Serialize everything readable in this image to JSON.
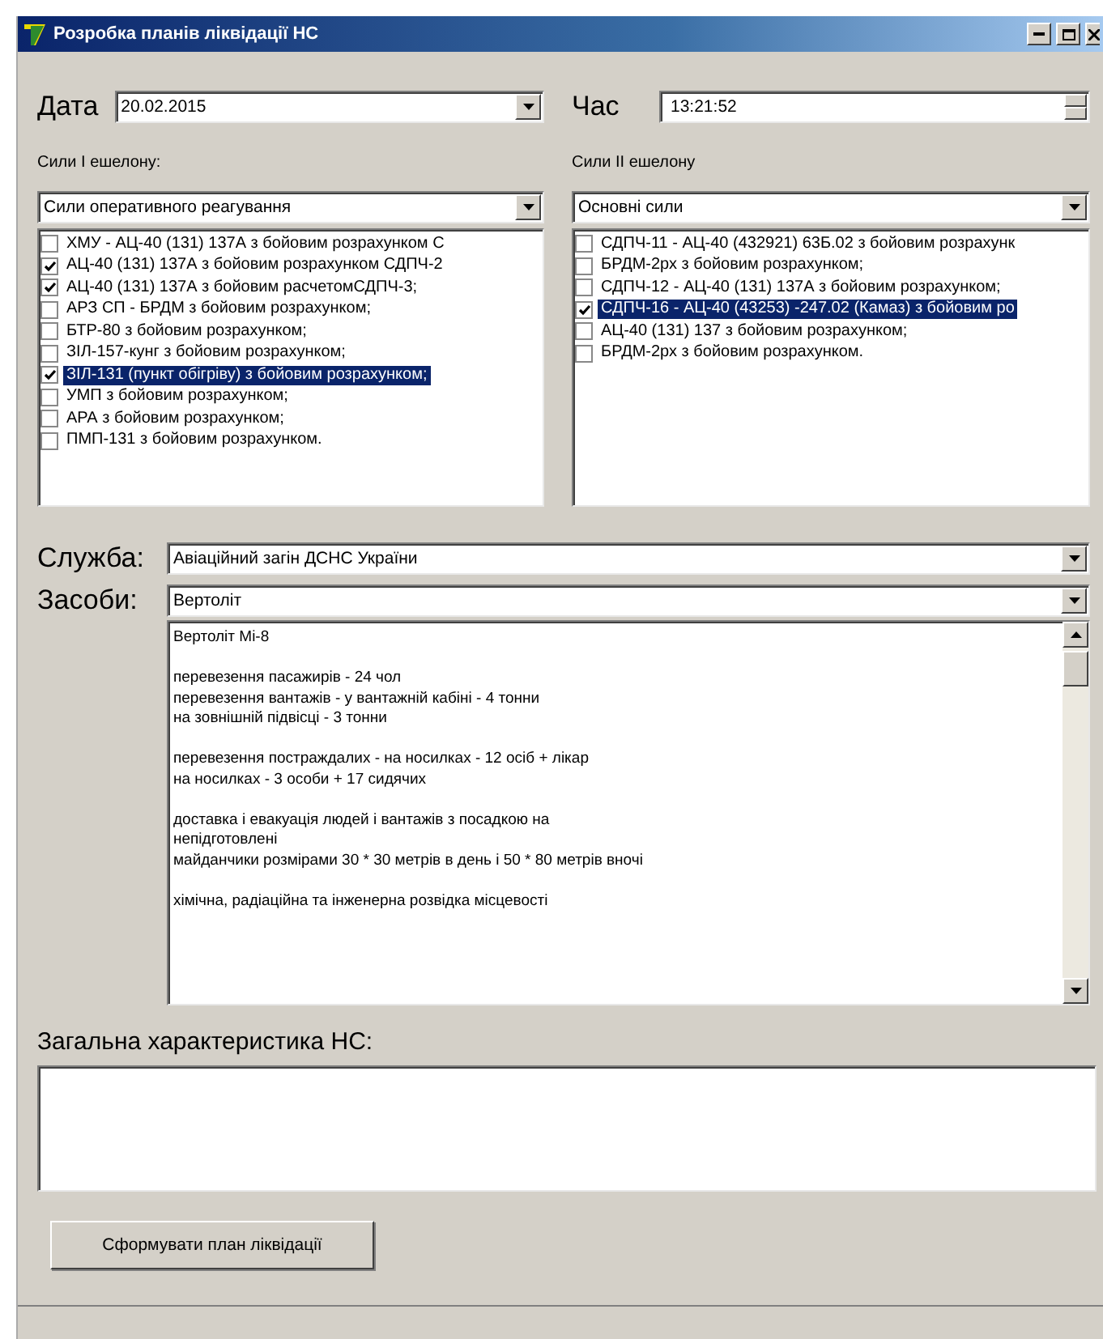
{
  "window": {
    "title": "Розробка планів ліквідації НС"
  },
  "date": {
    "label": "Дата",
    "value": "20.02.2015"
  },
  "time": {
    "label": "Час",
    "value": "13:21:52"
  },
  "echelons": [
    {
      "label": "Сили I ешелону:",
      "combo": "Сили оперативного реагування",
      "items": [
        {
          "text": "ХМУ - АЦ-40 (131) 137А з бойовим розрахунком С",
          "checked": false,
          "selected": false
        },
        {
          "text": "АЦ-40 (131) 137А з бойовим розрахунком СДПЧ-2",
          "checked": true,
          "selected": false
        },
        {
          "text": "АЦ-40 (131) 137А з бойовим расчетомСДПЧ-3;",
          "checked": true,
          "selected": false
        },
        {
          "text": "АРЗ СП - БРДМ з бойовим розрахунком;",
          "checked": false,
          "selected": false
        },
        {
          "text": "БТР-80 з бойовим розрахунком;",
          "checked": false,
          "selected": false
        },
        {
          "text": "ЗІЛ-157-кунг з бойовим розрахунком;",
          "checked": false,
          "selected": false
        },
        {
          "text": "ЗІЛ-131 (пункт обігріву) з бойовим розрахунком;",
          "checked": true,
          "selected": true
        },
        {
          "text": "УМП з бойовим розрахунком;",
          "checked": false,
          "selected": false
        },
        {
          "text": "АРА з бойовим розрахунком;",
          "checked": false,
          "selected": false
        },
        {
          "text": "ПМП-131 з бойовим розрахунком.",
          "checked": false,
          "selected": false
        }
      ]
    },
    {
      "label": "Сили II  ешелону",
      "combo": "Основні сили",
      "items": [
        {
          "text": "СДПЧ-11 - АЦ-40 (432921) 63Б.02 з бойовим розрахунк",
          "checked": false,
          "selected": false
        },
        {
          "text": "БРДМ-2рх з бойовим розрахунком;",
          "checked": false,
          "selected": false
        },
        {
          "text": "СДПЧ-12 - АЦ-40 (131) 137А з бойовим розрахунком;",
          "checked": false,
          "selected": false
        },
        {
          "text": "СДПЧ-16 - АЦ-40 (43253) -247.02 (Камаз) з бойовим ро",
          "checked": true,
          "selected": true
        },
        {
          "text": "АЦ-40 (131) 137 з бойовим розрахунком;",
          "checked": false,
          "selected": false
        },
        {
          "text": "БРДМ-2рх з бойовим розрахунком.",
          "checked": false,
          "selected": false
        }
      ]
    }
  ],
  "service": {
    "label": "Служба:",
    "value": "Авіаційний загін  ДСНС України"
  },
  "means": {
    "label": "Засоби:",
    "value": "Вертоліт",
    "description": [
      [
        "Вертоліт Мі-8"
      ],
      [
        "перевезення пасажирів - 24 чол",
        "перевезення вантажів - у вантажній кабіні - 4 тонни",
        "на зовнішній підвісці - 3 тонни"
      ],
      [
        "перевезення постраждалих - на носилках - 12 осіб + лікар",
        "на носилках - 3 особи + 17 сидячих"
      ],
      [
        "доставка і евакуація людей і вантажів з посадкою на",
        "непідготовлені",
        "майданчики розмірами 30 * 30 метрів в день і 50 * 80 метрів вночі"
      ],
      [
        "хімічна, радіаційна та інженерна розвідка місцевості"
      ]
    ]
  },
  "summary": {
    "label": "Загальна характеристика НС:"
  },
  "buttons": [
    {
      "label": "Сформувати план ліквідації"
    }
  ]
}
